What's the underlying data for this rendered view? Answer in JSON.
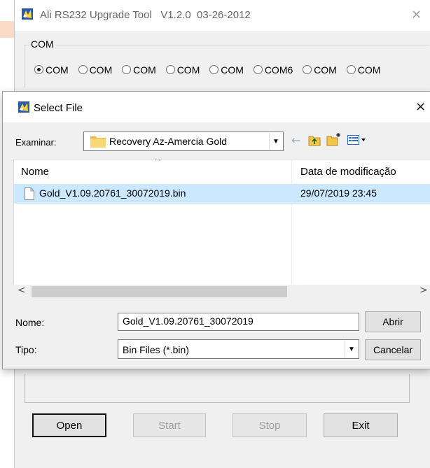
{
  "main_window": {
    "title": "Ali RS232 Upgrade Tool   V1.2.0  03-26-2012",
    "close_glyph": "×",
    "com_group_label": "COM",
    "com_ports": [
      "COM",
      "COM",
      "COM",
      "COM",
      "COM",
      "COM6",
      "COM",
      "COM"
    ],
    "buttons": {
      "open": "Open",
      "start": "Start",
      "stop": "Stop",
      "exit": "Exit"
    }
  },
  "dialog": {
    "title": "Select File",
    "close_glyph": "×",
    "look_in_label": "Examinar:",
    "look_in_value": "Recovery Az-Amercia Gold",
    "list": {
      "columns": {
        "name": "Nome",
        "date": "Data de modificação"
      },
      "rows": [
        {
          "name": "Gold_V1.09.20761_30072019.bin",
          "date": "29/07/2019 23:45",
          "selected": true
        }
      ]
    },
    "filename_label": "Nome:",
    "filename_value": "Gold_V1.09.20761_30072019",
    "filetype_label": "Tipo:",
    "filetype_value": "Bin Files (*.bin)",
    "open_button": "Abrir",
    "cancel_button": "Cancelar"
  },
  "colors": {
    "selection": "#cce8ff",
    "dialog_bg": "#f0f0f0",
    "folder_yellow": "#f8d775"
  }
}
